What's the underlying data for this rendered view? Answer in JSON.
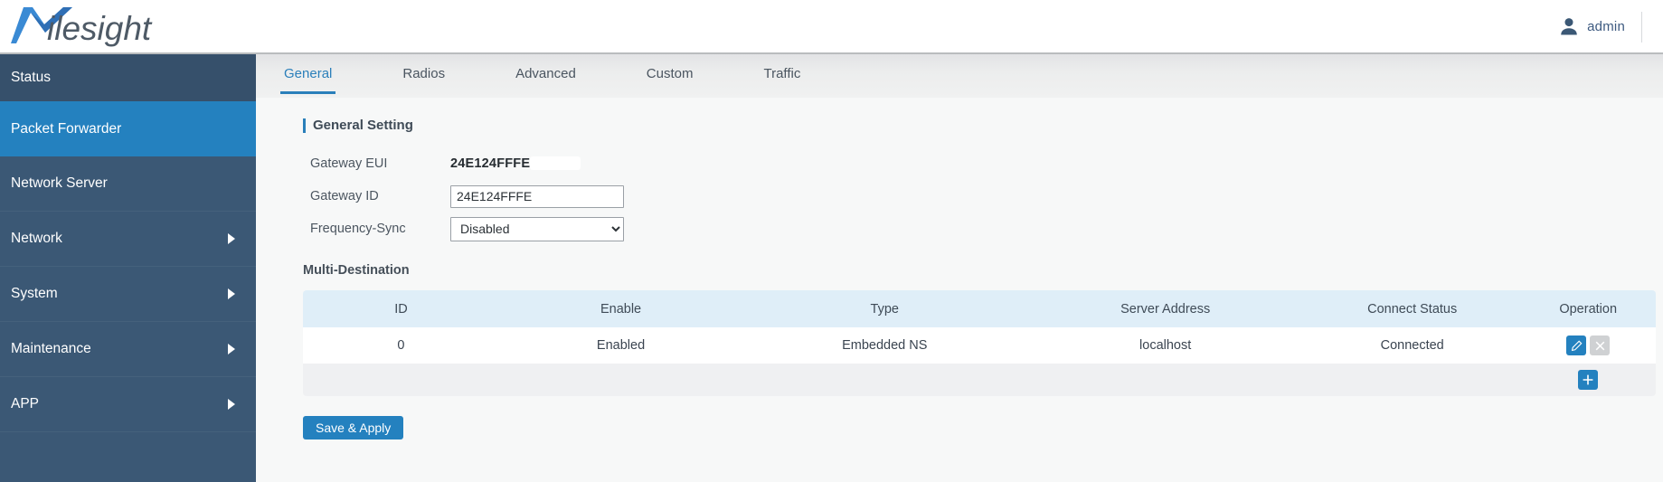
{
  "header": {
    "brand": "Milesight",
    "user_label": "admin",
    "user_icon": "user-icon"
  },
  "sidebar": {
    "items": [
      {
        "label": "Status",
        "has_caret": false,
        "active": false
      },
      {
        "label": "Packet Forwarder",
        "has_caret": false,
        "active": true
      },
      {
        "label": "Network Server",
        "has_caret": false,
        "active": false
      },
      {
        "label": "Network",
        "has_caret": true,
        "active": false
      },
      {
        "label": "System",
        "has_caret": true,
        "active": false
      },
      {
        "label": "Maintenance",
        "has_caret": true,
        "active": false
      },
      {
        "label": "APP",
        "has_caret": true,
        "active": false
      },
      {
        "label": "",
        "has_caret": false,
        "active": false
      }
    ]
  },
  "tabs": [
    {
      "label": "General",
      "active": true
    },
    {
      "label": "Radios",
      "active": false
    },
    {
      "label": "Advanced",
      "active": false
    },
    {
      "label": "Custom",
      "active": false
    },
    {
      "label": "Traffic",
      "active": false
    }
  ],
  "general_setting": {
    "title": "General Setting",
    "gateway_eui_label": "Gateway EUI",
    "gateway_eui_value": "24E124FFFE",
    "gateway_id_label": "Gateway ID",
    "gateway_id_value": "24E124FFFE",
    "frequency_sync_label": "Frequency-Sync",
    "frequency_sync_value": "Disabled",
    "frequency_sync_options": [
      "Disabled"
    ]
  },
  "multi_destination": {
    "title": "Multi-Destination",
    "columns": [
      "ID",
      "Enable",
      "Type",
      "Server Address",
      "Connect Status",
      "Operation"
    ],
    "rows": [
      {
        "id": "0",
        "enable": "Enabled",
        "type": "Embedded NS",
        "server_address": "localhost",
        "connect_status": "Connected"
      }
    ],
    "edit_icon": "pencil-icon",
    "delete_icon": "close-x-icon",
    "add_icon": "plus-icon"
  },
  "actions": {
    "save_label": "Save & Apply"
  },
  "colors": {
    "accent_blue": "#2481bf",
    "sidebar_bg": "#3b5875",
    "sidebar_top": "#36506b",
    "table_header": "#dfeef8",
    "content_bg": "#f7f8f8"
  }
}
